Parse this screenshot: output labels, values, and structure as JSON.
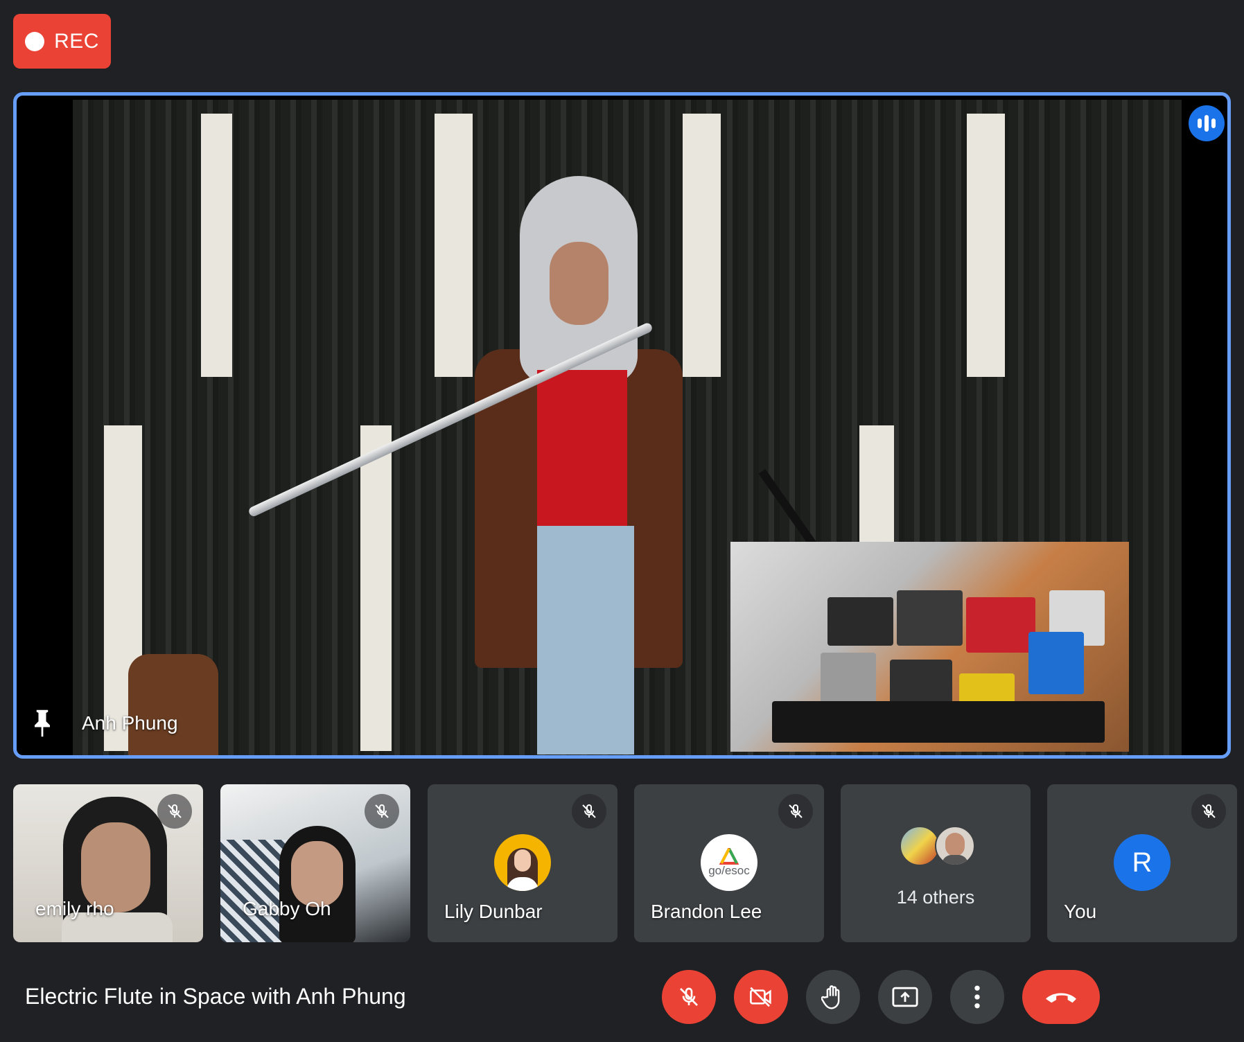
{
  "recording": {
    "label": "REC",
    "color": "#ea4335"
  },
  "main_speaker": {
    "name": "Anh Phung",
    "pin_icon": "pin-icon",
    "speaking_icon": "audio-level-icon",
    "highlight": "#669df6"
  },
  "participants": [
    {
      "name": "emily rho",
      "type": "video",
      "muted": true
    },
    {
      "name": "Gabby Oh",
      "type": "video",
      "muted": true
    },
    {
      "name": "Lily Dunbar",
      "type": "avatar-photo",
      "muted": true
    },
    {
      "name": "Brandon Lee",
      "type": "avatar-logo",
      "logo_text": "go/esoc",
      "muted": true
    },
    {
      "name": "14 others",
      "type": "group"
    },
    {
      "name": "You",
      "type": "initial",
      "initial": "R",
      "avatar_color": "#1a73e8",
      "muted": true
    }
  ],
  "meeting": {
    "title": "Electric Flute in Space with Anh Phung"
  },
  "controls": [
    {
      "name": "microphone-off",
      "icon": "mic-off-icon",
      "state": "off"
    },
    {
      "name": "camera-off",
      "icon": "videocam-off-icon",
      "state": "off"
    },
    {
      "name": "raise-hand",
      "icon": "hand-icon"
    },
    {
      "name": "present-screen",
      "icon": "present-icon"
    },
    {
      "name": "more-options",
      "icon": "more-vert-icon"
    },
    {
      "name": "leave-call",
      "icon": "call-end-icon"
    }
  ]
}
